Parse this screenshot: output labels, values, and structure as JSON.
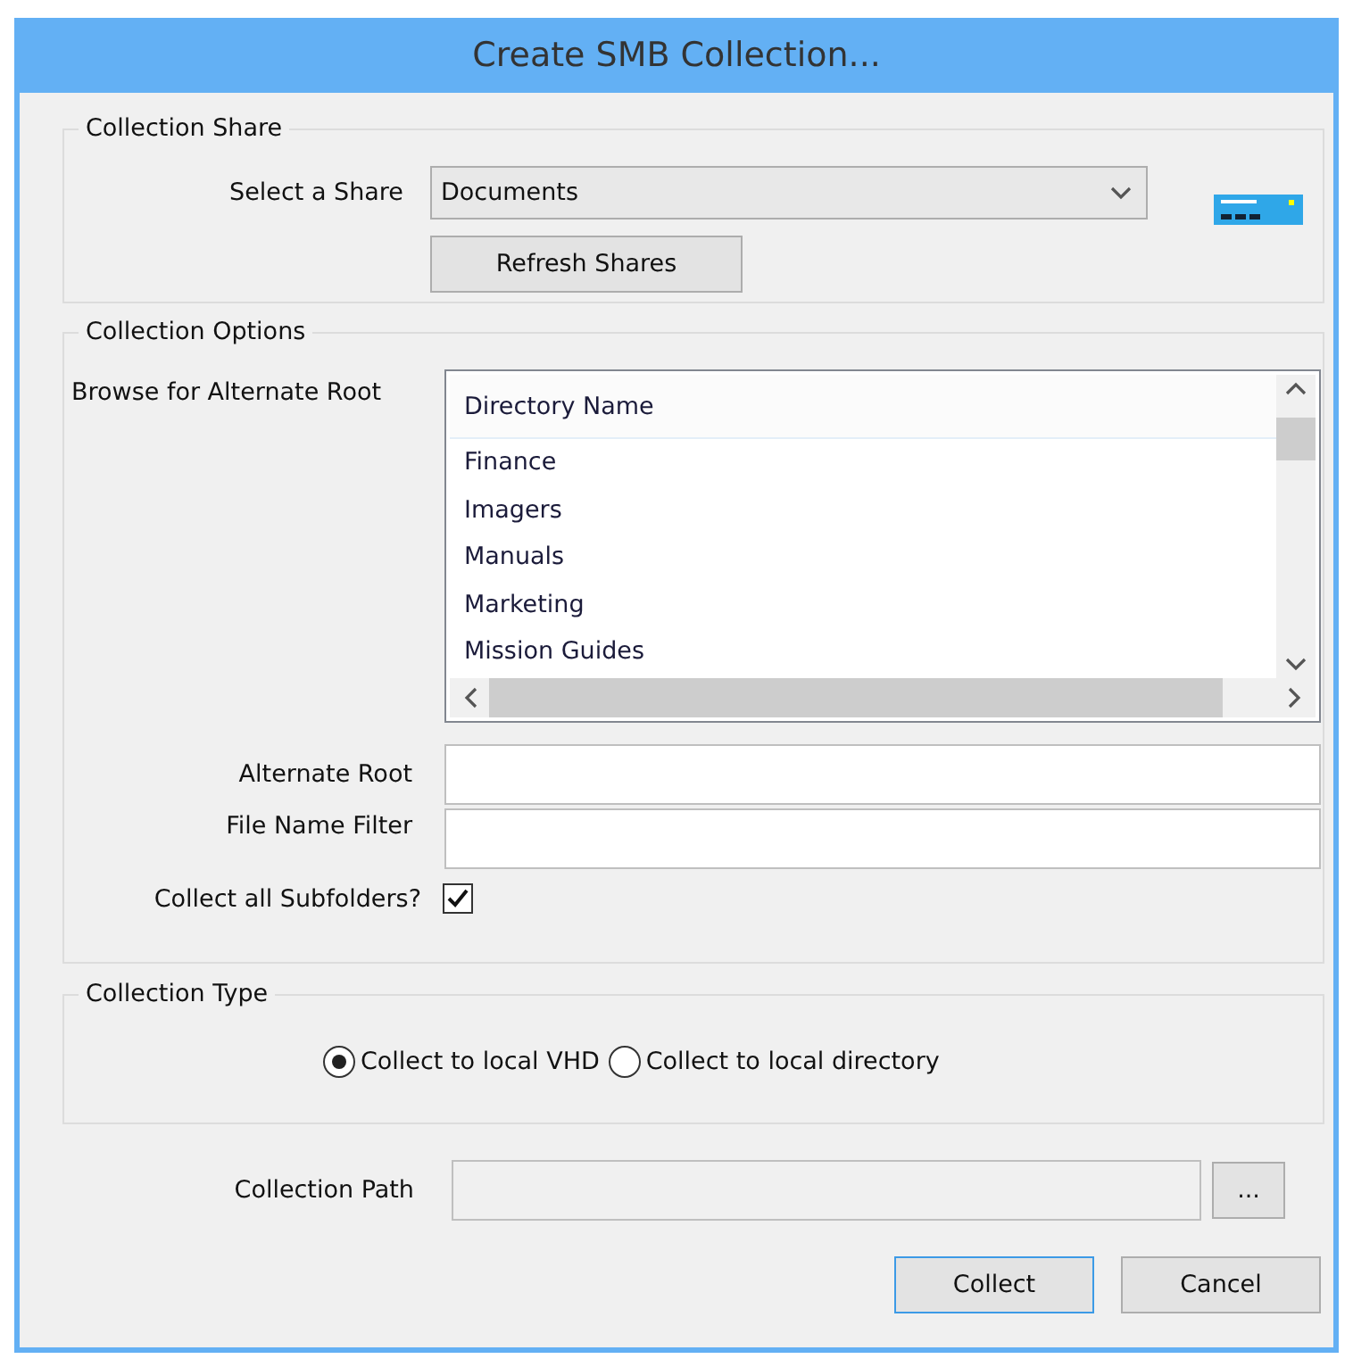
{
  "window": {
    "title": "Create SMB Collection..."
  },
  "collection_share": {
    "legend": "Collection Share",
    "label": "Select a Share",
    "value": "Documents",
    "refresh_button": "Refresh Shares"
  },
  "collection_options": {
    "legend": "Collection Options",
    "browse_label": "Browse for Alternate Root",
    "directory_list": {
      "column": "Directory Name",
      "rows": [
        {
          "name": "Finance",
          "selected": false
        },
        {
          "name": "Imagers",
          "selected": false
        },
        {
          "name": "Manuals",
          "selected": false
        },
        {
          "name": "Marketing",
          "selected": false
        },
        {
          "name": "Mission Guides",
          "selected": false
        }
      ]
    },
    "alternate_root": {
      "label": "Alternate Root"
    },
    "file_name_filter": {
      "label": "File Name Filter"
    },
    "collect_all_subfolders": {
      "label": "Collect all Subfolders?",
      "checked": true
    }
  },
  "collection_type": {
    "legend": "Collection Type",
    "options": [
      {
        "label": "Collect to local VHD",
        "selected": true
      },
      {
        "label": "Collect to local directory",
        "selected": false
      }
    ]
  },
  "collection_path": {
    "label": "Collection Path",
    "disabled": true,
    "browse_button": "..."
  },
  "buttons": [
    {
      "label": "Collect",
      "default": true
    },
    {
      "label": "Cancel",
      "default": false
    }
  ]
}
